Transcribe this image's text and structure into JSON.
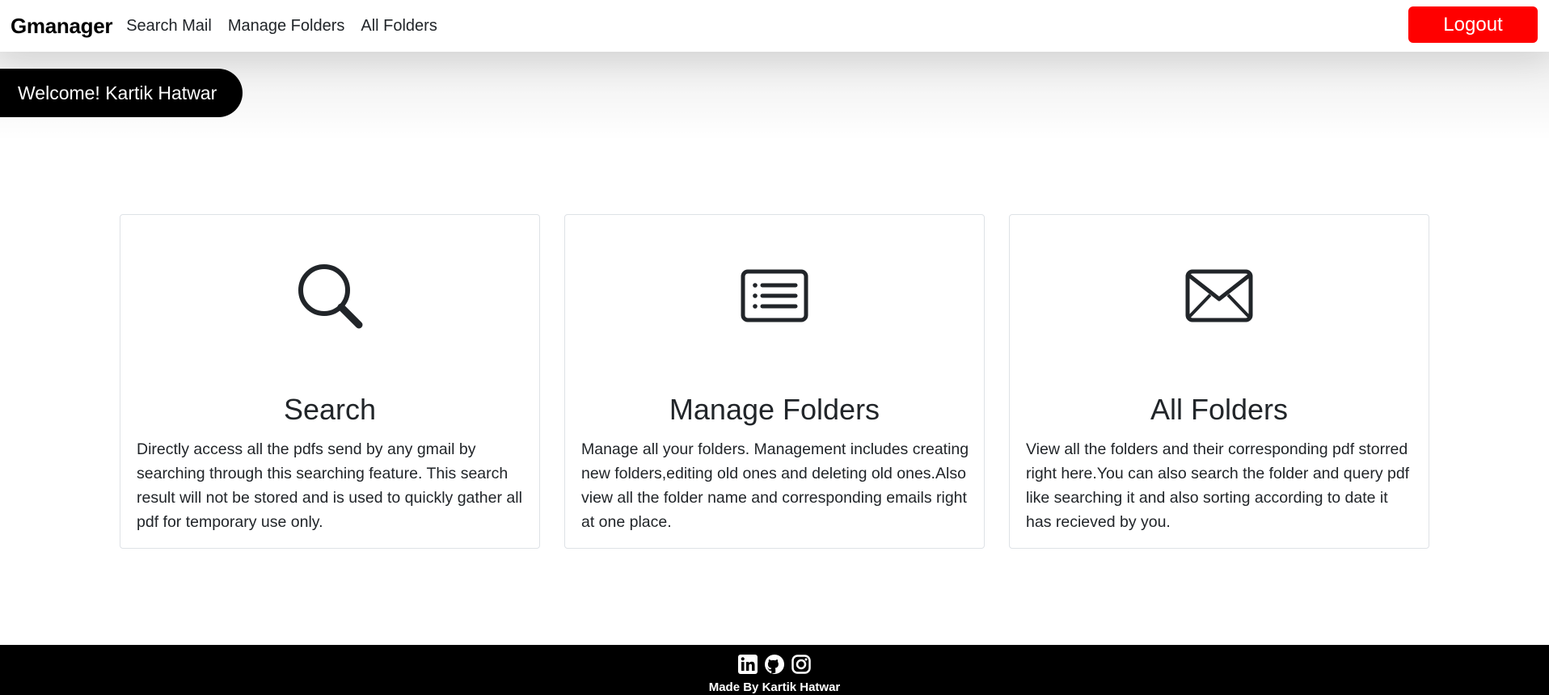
{
  "navbar": {
    "brand": "Gmanager",
    "links": [
      "Search Mail",
      "Manage Folders",
      "All Folders"
    ],
    "logout_label": "Logout"
  },
  "welcome": "Welcome! Kartik Hatwar",
  "cards": [
    {
      "icon": "search-icon",
      "title": "Search",
      "text": "Directly access all the pdfs send by any gmail by searching through this searching feature. This search result will not be stored and is used to quickly gather all pdf for temporary use only."
    },
    {
      "icon": "list-card-icon",
      "title": "Manage Folders",
      "text": "Manage all your folders. Management includes creating new folders,editing old ones and deleting old ones.Also view all the folder name and corresponding emails right at one place."
    },
    {
      "icon": "envelope-icon",
      "title": "All Folders",
      "text": "View all the folders and their corresponding pdf storred right here.You can also search the folder and query pdf like searching it and also sorting according to date it has recieved by you."
    }
  ],
  "footer": {
    "social": [
      "linkedin-icon",
      "github-icon",
      "instagram-icon"
    ],
    "made_by": "Made By Kartik Hatwar"
  },
  "colors": {
    "accent": "#ff0000",
    "dark": "#000000",
    "text": "#212529",
    "border": "#dee2e6"
  }
}
